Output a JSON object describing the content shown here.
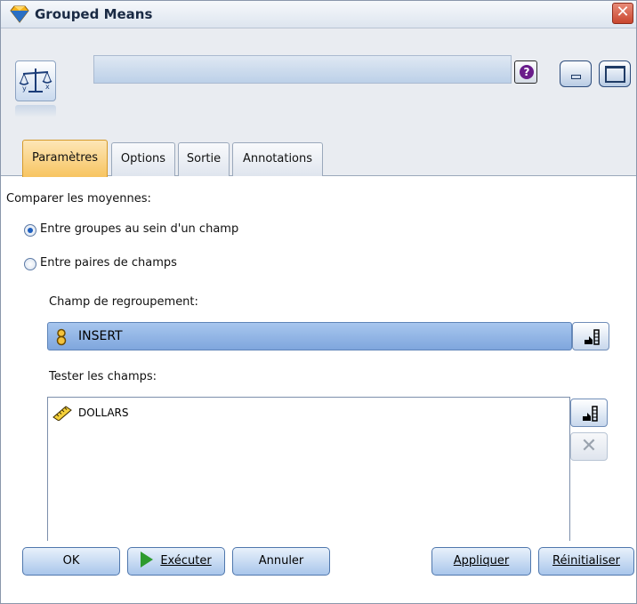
{
  "window": {
    "title": "Grouped Means"
  },
  "tabs": [
    {
      "label": "Paramètres",
      "active": true
    },
    {
      "label": "Options",
      "active": false
    },
    {
      "label": "Sortie",
      "active": false
    },
    {
      "label": "Annotations",
      "active": false
    }
  ],
  "settings": {
    "compare_label": "Comparer les moyennes:",
    "radio_within": {
      "label": "Entre groupes au sein d'un champ",
      "selected": true
    },
    "radio_pairs": {
      "label": "Entre paires de champs",
      "selected": false
    },
    "grouping_label": "Champ de regroupement:",
    "grouping_value": "INSERT",
    "test_fields_label": "Tester les champs:",
    "test_fields": [
      "DOLLARS"
    ]
  },
  "buttons": {
    "ok": "OK",
    "run": "Exécuter",
    "cancel": "Annuler",
    "apply": "Appliquer",
    "reset": "Réinitialiser"
  },
  "icons": {
    "app": "spss-diamond-icon",
    "node": "balance-scale-icon",
    "help": "help-icon",
    "minimize": "minimize-icon",
    "maximize": "maximize-icon",
    "close": "close-icon",
    "grouping_type": "flag-field-icon",
    "test_field_type": "ruler-continuous-icon",
    "picker": "field-picker-icon",
    "delete": "delete-x-icon",
    "run": "run-play-icon"
  },
  "colors": {
    "active_tab": "#f7c461",
    "combo_fill": "#8fb2e4",
    "button_fill": "#bcd3ef",
    "run_green": "#2e9b2e",
    "close_red": "#c9462e"
  }
}
